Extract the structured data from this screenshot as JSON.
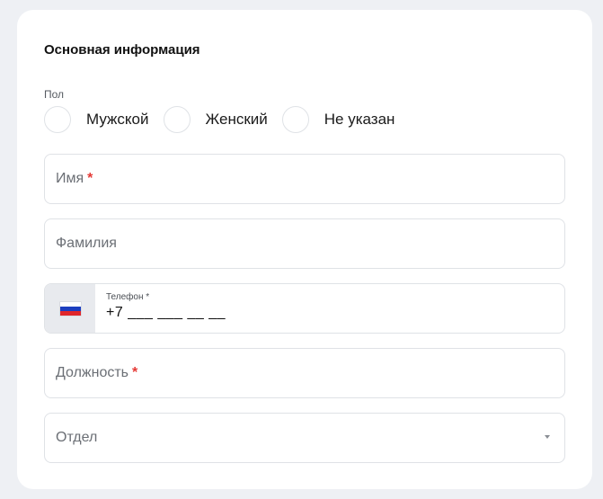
{
  "section": {
    "title": "Основная информация"
  },
  "gender": {
    "label": "Пол",
    "options": [
      {
        "label": "Мужской"
      },
      {
        "label": "Женский"
      },
      {
        "label": "Не указан"
      }
    ]
  },
  "fields": {
    "first_name": {
      "placeholder": "Имя",
      "required_mark": "*"
    },
    "last_name": {
      "placeholder": "Фамилия"
    },
    "phone": {
      "label": "Телефон *",
      "value": "+7 ___ ___ __ __",
      "country_flag_icon": "russia-flag-icon"
    },
    "position": {
      "placeholder": "Должность",
      "required_mark": "*"
    },
    "department": {
      "placeholder": "Отдел",
      "dropdown_icon": "chevron-down-icon"
    }
  },
  "colors": {
    "required": "#e53935",
    "border": "#dfe2e6",
    "flag_box": "#e8eaee"
  }
}
